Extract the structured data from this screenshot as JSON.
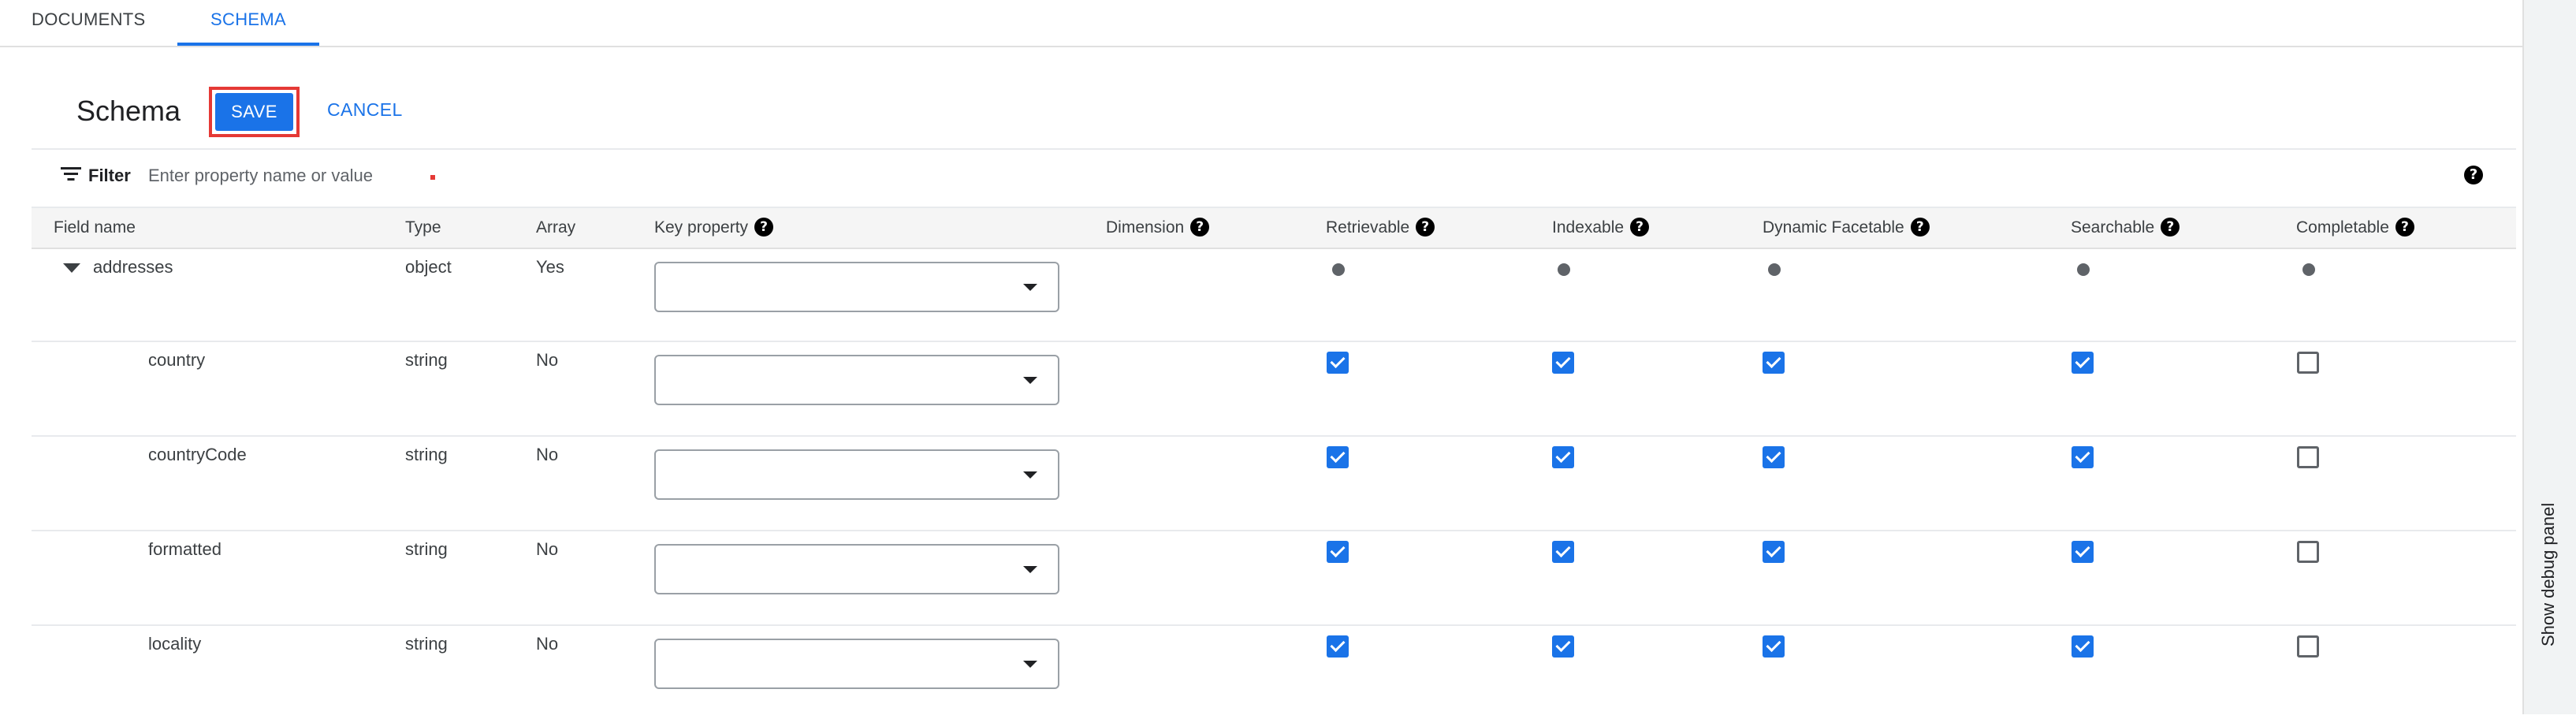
{
  "tabs": [
    {
      "label": "DOCUMENTS"
    },
    {
      "label": "SCHEMA"
    }
  ],
  "header": {
    "title": "Schema",
    "save_label": "SAVE",
    "cancel_label": "CANCEL"
  },
  "filter": {
    "label": "Filter",
    "placeholder": "Enter property name or value",
    "help_icon": "help-icon"
  },
  "table": {
    "columns": [
      {
        "label": "Field name",
        "help": false
      },
      {
        "label": "Type",
        "help": false
      },
      {
        "label": "Array",
        "help": false
      },
      {
        "label": "Key property",
        "help": true
      },
      {
        "label": "Dimension",
        "help": true
      },
      {
        "label": "Retrievable",
        "help": true
      },
      {
        "label": "Indexable",
        "help": true
      },
      {
        "label": "Dynamic Facetable",
        "help": true
      },
      {
        "label": "Searchable",
        "help": true
      },
      {
        "label": "Completable",
        "help": true
      }
    ],
    "rows": [
      {
        "name": "addresses",
        "type": "object",
        "array": "Yes",
        "key_property": "",
        "expandable": true,
        "indicator": "dot",
        "retrievable": null,
        "indexable": null,
        "dynamic_facetable": null,
        "searchable": null,
        "completable": null
      },
      {
        "name": "country",
        "type": "string",
        "array": "No",
        "key_property": "",
        "expandable": false,
        "indicator": "checkbox",
        "retrievable": true,
        "indexable": true,
        "dynamic_facetable": true,
        "searchable": true,
        "completable": false
      },
      {
        "name": "countryCode",
        "type": "string",
        "array": "No",
        "key_property": "",
        "expandable": false,
        "indicator": "checkbox",
        "retrievable": true,
        "indexable": true,
        "dynamic_facetable": true,
        "searchable": true,
        "completable": false
      },
      {
        "name": "formatted",
        "type": "string",
        "array": "No",
        "key_property": "",
        "expandable": false,
        "indicator": "checkbox",
        "retrievable": true,
        "indexable": true,
        "dynamic_facetable": true,
        "searchable": true,
        "completable": false
      },
      {
        "name": "locality",
        "type": "string",
        "array": "No",
        "key_property": "",
        "expandable": false,
        "indicator": "checkbox",
        "retrievable": true,
        "indexable": true,
        "dynamic_facetable": true,
        "searchable": true,
        "completable": false
      }
    ]
  },
  "debug_panel": {
    "label": "Show debug panel"
  },
  "colors": {
    "accent": "#1a73e8",
    "highlight_border": "#e53935"
  }
}
